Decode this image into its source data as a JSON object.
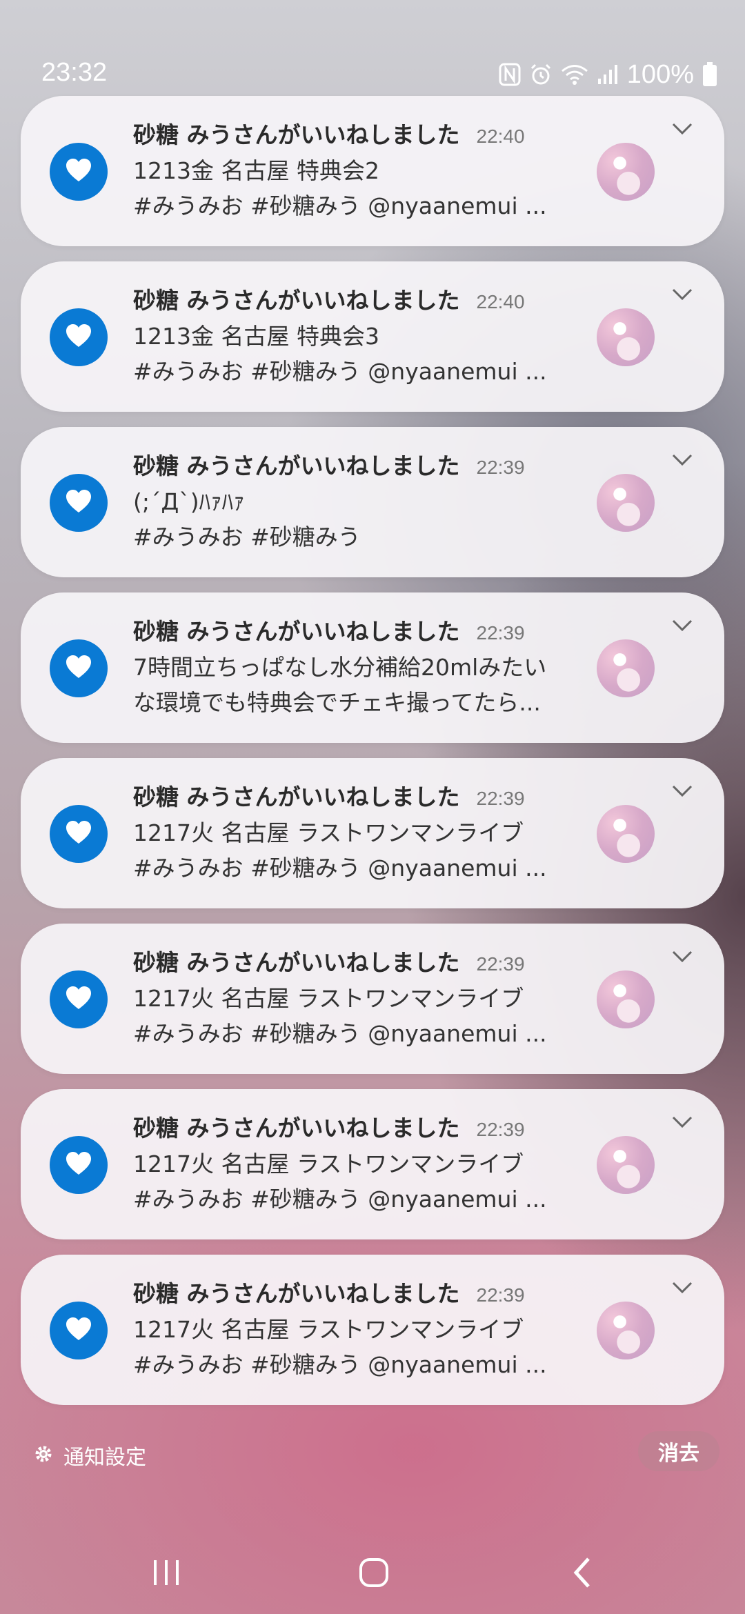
{
  "status_bar": {
    "time": "23:32",
    "battery": "100%",
    "icons": [
      "nfc-icon",
      "alarm-icon",
      "wifi-icon",
      "signal-icon",
      "battery-icon"
    ]
  },
  "notifications": [
    {
      "title": "砂糖 みうさんがいいねしました",
      "time": "22:40",
      "line1": "1213金 名古屋 特典会2",
      "line2": "#みうみお #砂糖みう @nyaanemui ..."
    },
    {
      "title": "砂糖 みうさんがいいねしました",
      "time": "22:40",
      "line1": "1213金 名古屋 特典会3",
      "line2": "#みうみお #砂糖みう @nyaanemui ..."
    },
    {
      "title": "砂糖 みうさんがいいねしました",
      "time": "22:39",
      "line1": "(;´Д`)ﾊｧﾊｧ",
      "line2": "#みうみお #砂糖みう"
    },
    {
      "title": "砂糖 みうさんがいいねしました",
      "time": "22:39",
      "line1": "7時間立ちっぱなし水分補給20mlみたい",
      "line2": "な環境でも特典会でチェキ撮ってたら..."
    },
    {
      "title": "砂糖 みうさんがいいねしました",
      "time": "22:39",
      "line1": "1217火 名古屋 ラストワンマンライブ",
      "line2": "#みうみお #砂糖みう @nyaanemui ..."
    },
    {
      "title": "砂糖 みうさんがいいねしました",
      "time": "22:39",
      "line1": "1217火 名古屋 ラストワンマンライブ",
      "line2": "#みうみお #砂糖みう @nyaanemui ..."
    },
    {
      "title": "砂糖 みうさんがいいねしました",
      "time": "22:39",
      "line1": "1217火 名古屋 ラストワンマンライブ",
      "line2": "#みうみお #砂糖みう @nyaanemui ..."
    },
    {
      "title": "砂糖 みうさんがいいねしました",
      "time": "22:39",
      "line1": "1217火 名古屋 ラストワンマンライブ",
      "line2": "#みうみお #砂糖みう @nyaanemui ..."
    }
  ],
  "footer": {
    "settings_label": "通知設定",
    "clear_label": "消去"
  },
  "colors": {
    "app_icon": "#0a7ad4",
    "card_bg": "#f6f4f7"
  }
}
